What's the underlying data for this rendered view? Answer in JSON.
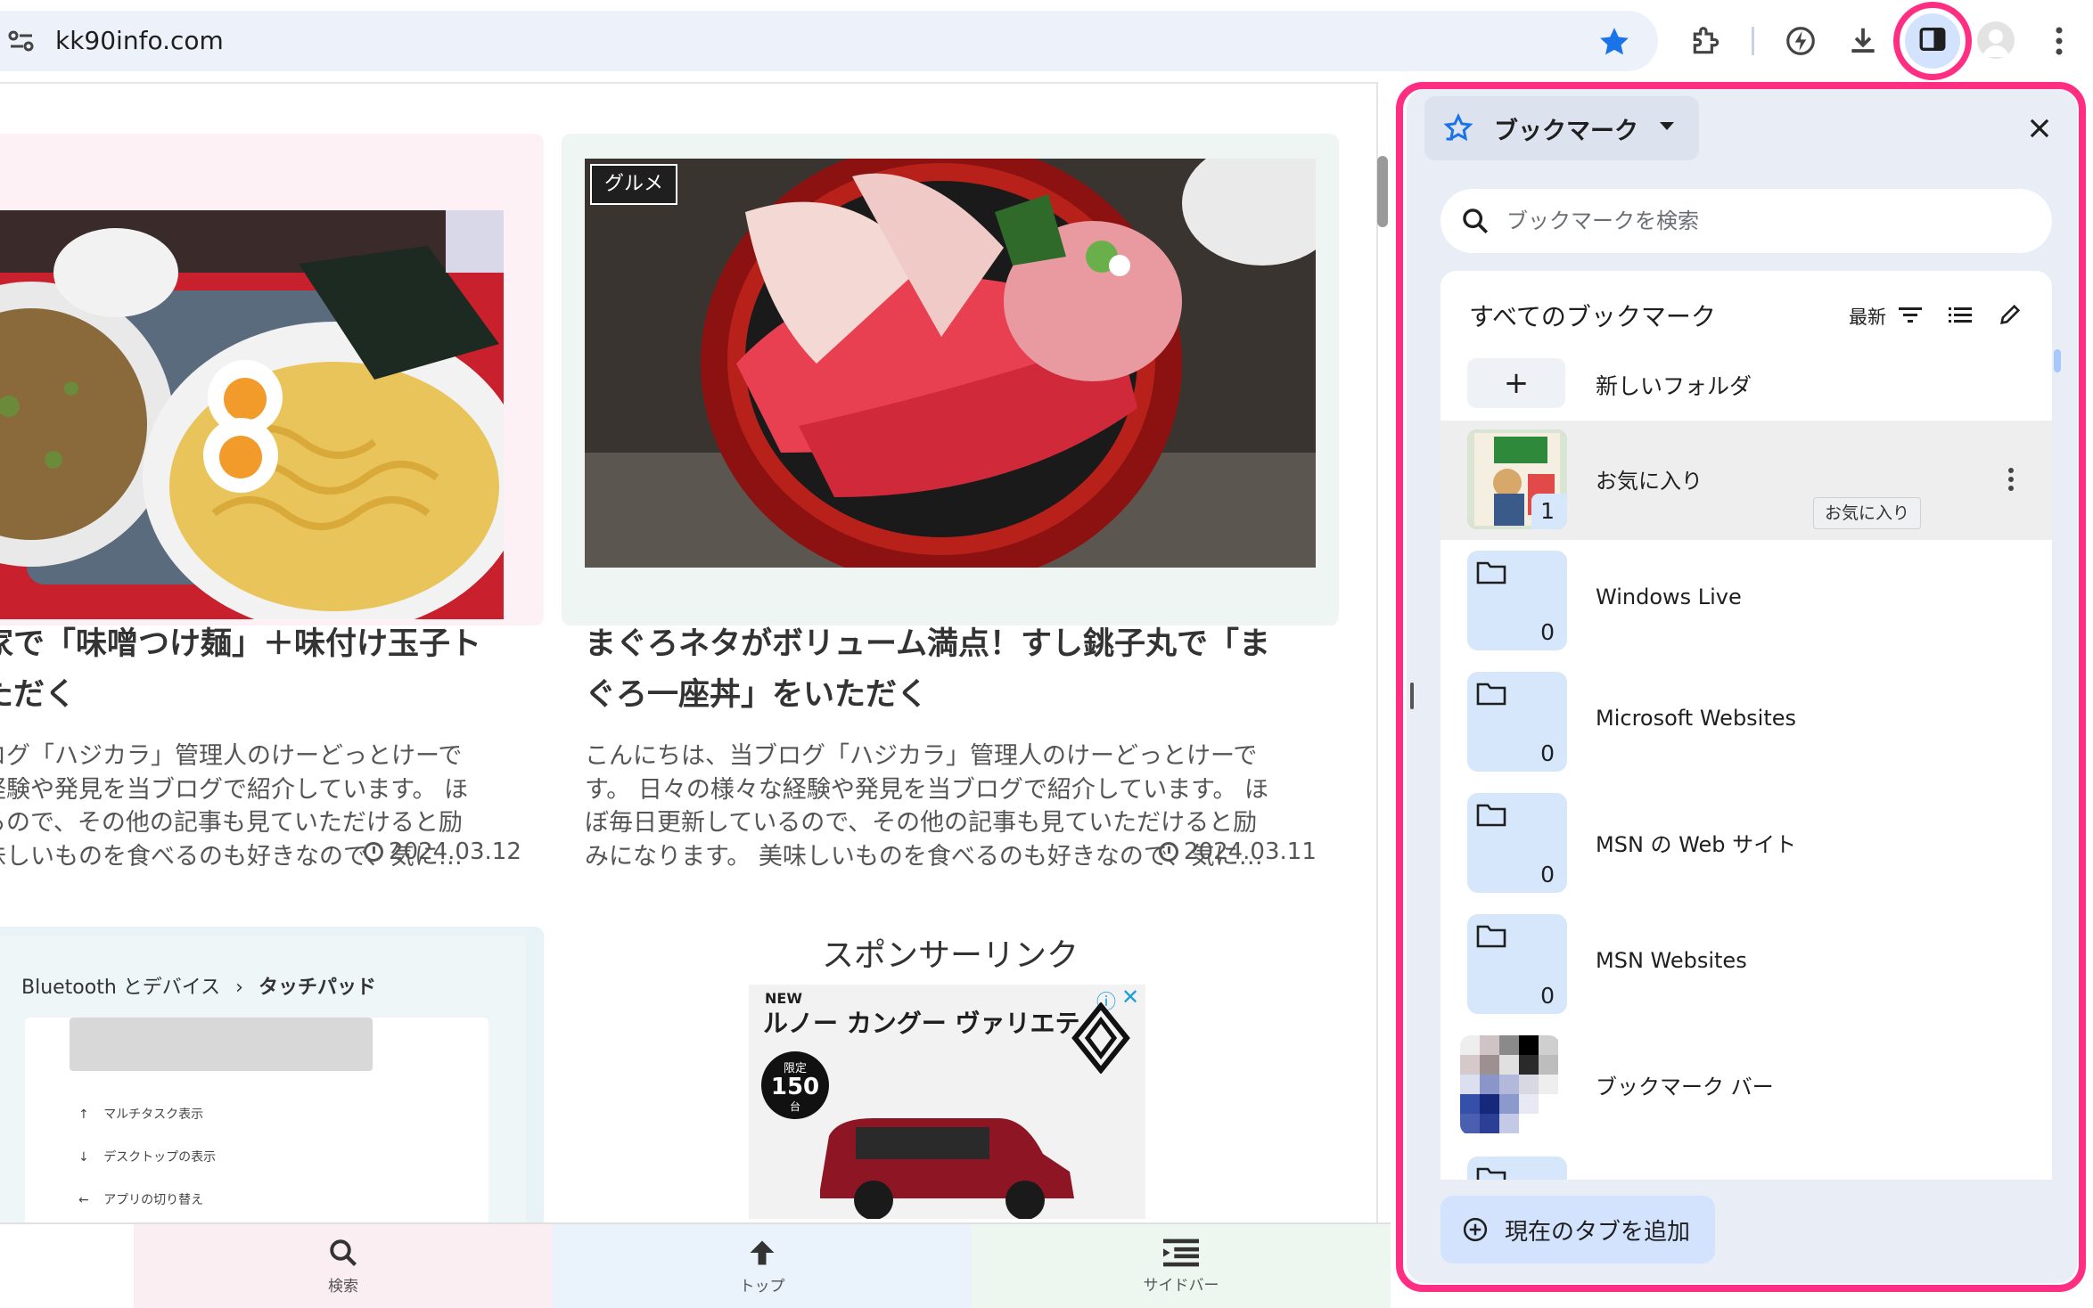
{
  "toolbar": {
    "url": "kk90info.com",
    "icons": [
      "site-info-icon",
      "star-icon",
      "extensions-icon",
      "performance-icon",
      "download-icon",
      "side-panel-icon",
      "profile-avatar",
      "menu-icon"
    ],
    "accent": "#ff2e83",
    "star_color": "#1a73e8"
  },
  "page": {
    "cards": [
      {
        "title": "家で「味噌つけ麺」＋味付け玉子ト\nただく",
        "excerpt": "ログ「ハジカラ」管理人のけーどっとけーで\n経験や発見を当ブログで紹介しています。 ほ\nるので、その他の記事も見ていただけると励\n味しいものを食べるのも好きなので、気に…",
        "date": "2024.03.12",
        "bg": "#fdf1f5"
      },
      {
        "tag": "グルメ",
        "title": "まぐろネタがボリューム満点！すし銚子丸で「ま\nぐろ一座丼」をいただく",
        "excerpt": "こんにちは、当ブログ「ハジカラ」管理人のけーどっとけーで\nす。 日々の様々な経験や発見を当ブログで紹介しています。 ほ\nぼ毎日更新しているので、その他の記事も見ていただけると励\nみになります。 美味しいものを食べるのも好きなので、気に…",
        "date": "2024.03.11",
        "bg": "#eff5f2"
      }
    ],
    "preview_card": {
      "breadcrumb_parent": "Bluetooth とデバイス",
      "breadcrumb_sep": "›",
      "breadcrumb_current": "タッチパッド",
      "items": [
        "マルチタスク表示",
        "デスクトップの表示",
        "アプリの切り替え"
      ]
    },
    "sponsor": {
      "label": "スポンサーリンク",
      "ad_new": "NEW",
      "ad_title": "ルノー カングー ヴァリエテ",
      "ad_badge_top": "限定",
      "ad_badge_num": "150",
      "ad_badge_unit": "台"
    },
    "bottom_nav": [
      {
        "label": "検索",
        "icon": "search-icon",
        "bg": "#fbeef3"
      },
      {
        "label": "トップ",
        "icon": "arrow-up-icon",
        "bg": "#eaf3fb"
      },
      {
        "label": "サイドバー",
        "icon": "sidebar-menu-icon",
        "bg": "#edf6ef"
      }
    ]
  },
  "side_panel": {
    "title": "ブックマーク",
    "search_placeholder": "ブックマークを検索",
    "list_header": "すべてのブックマーク",
    "sort_label": "最新",
    "new_folder_symbol": "+",
    "new_folder_label": "新しいフォルダ",
    "items": [
      {
        "label": "お気に入り",
        "count": "1",
        "thumb": "image"
      },
      {
        "label": "Windows Live",
        "count": "0",
        "thumb": "folder"
      },
      {
        "label": "Microsoft Websites",
        "count": "0",
        "thumb": "folder"
      },
      {
        "label": "MSN の Web サイト",
        "count": "0",
        "thumb": "folder"
      },
      {
        "label": "MSN Websites",
        "count": "0",
        "thumb": "folder"
      },
      {
        "label": "ブックマーク バー",
        "count": "",
        "thumb": "mosaic"
      }
    ],
    "tooltip": "お気に入り",
    "add_tab_label": "現在のタブを追加"
  }
}
